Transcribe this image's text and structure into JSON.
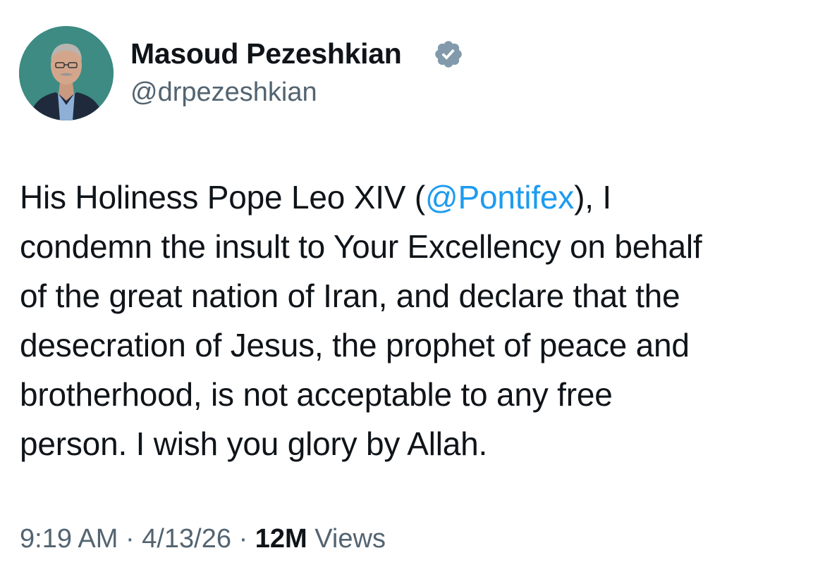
{
  "author": {
    "name": "Masoud Pezeshkian",
    "handle": "@drpezeshkian",
    "verified_badge_icon": "verified-badge-icon",
    "badge_color": "#829aab"
  },
  "tweet": {
    "lines": [
      {
        "before": "His Holiness Pope Leo XIV (",
        "mention": "@Pontifex",
        "after": "), I"
      },
      {
        "text": "condemn the insult to Your Excellency on behalf"
      },
      {
        "text": "of the great nation of Iran, and declare that the"
      },
      {
        "text": "desecration of Jesus, the prophet of peace and"
      },
      {
        "text": "brotherhood, is not acceptable to any free"
      },
      {
        "text": "person. I wish you glory by Allah."
      }
    ],
    "mention_color": "#1d9bf0"
  },
  "meta": {
    "time": "9:19 AM",
    "separator": "·",
    "date": "4/13/26",
    "views_count": "12M",
    "views_label": "Views"
  }
}
